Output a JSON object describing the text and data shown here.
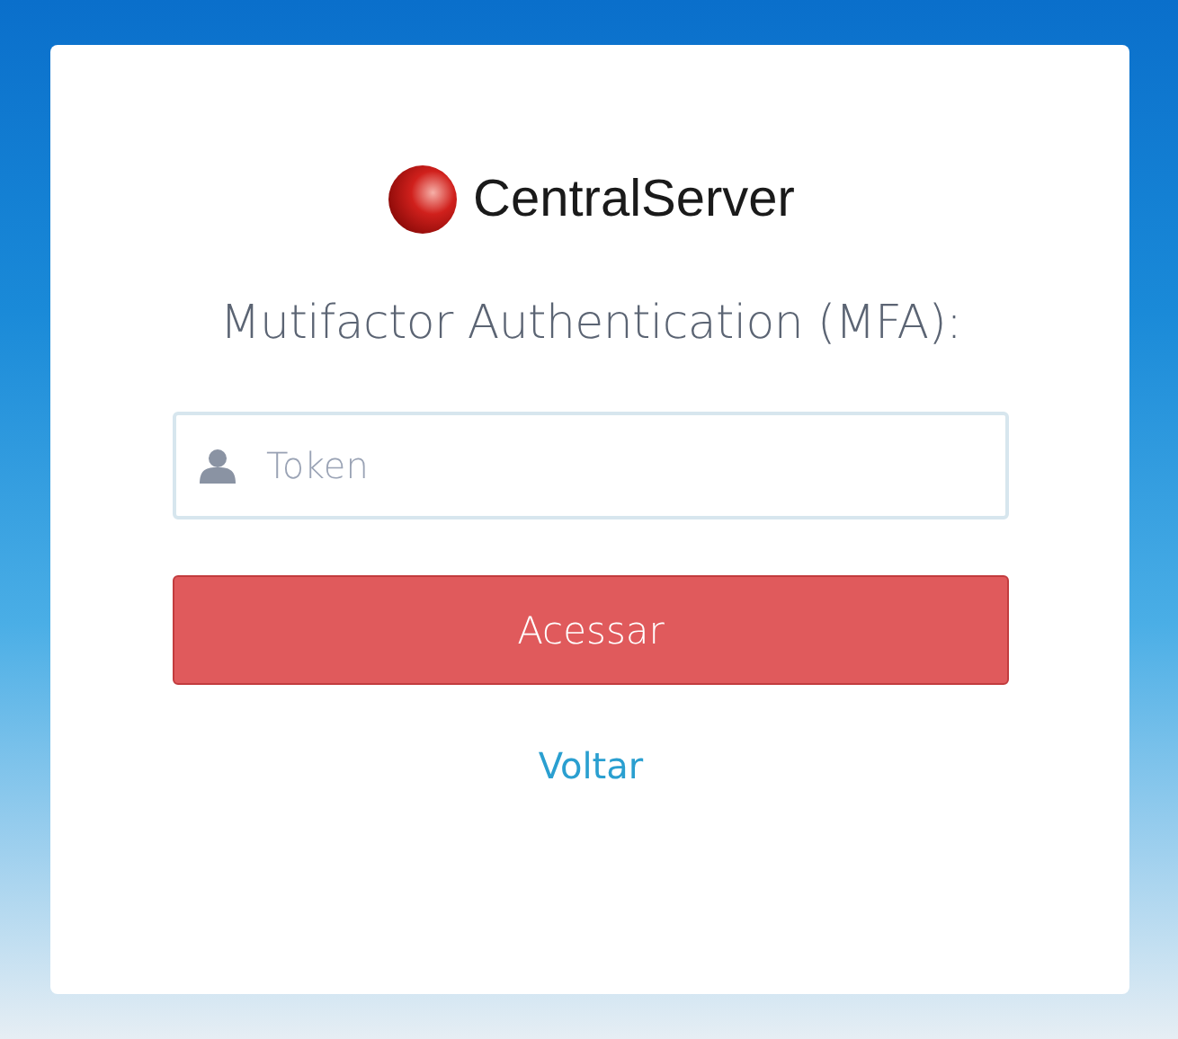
{
  "logo": {
    "text": "CentralServer"
  },
  "title": "Mutifactor Authentication (MFA):",
  "token_field": {
    "placeholder": "Token"
  },
  "submit_button": "Acessar",
  "back_link": "Voltar"
}
